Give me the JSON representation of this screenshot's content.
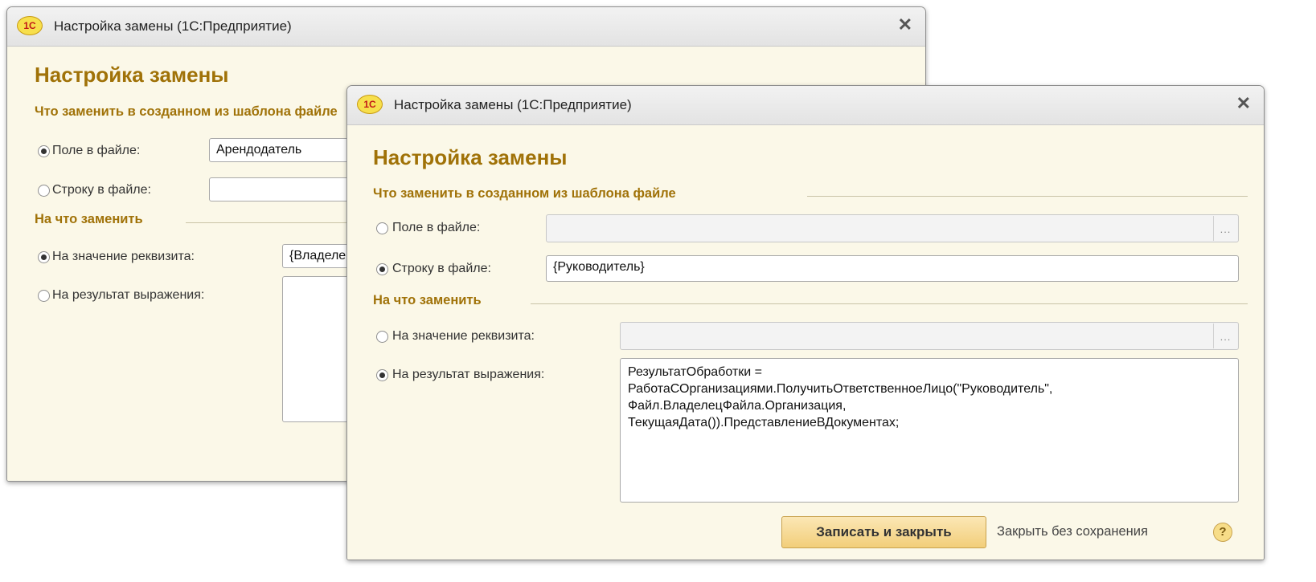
{
  "back_window": {
    "app_icon": "1C",
    "title": "Настройка замены  (1С:Предприятие)",
    "close_icon": "✕",
    "form_title": "Настройка замены",
    "group_what": "Что заменить в созданном из шаблона файле",
    "radio_field_label": "Поле в файле:",
    "radio_field_selected": true,
    "field_value": "Арендодатель",
    "radio_string_label": "Строку в файле:",
    "radio_string_selected": false,
    "string_value": "",
    "group_to": "На что заменить",
    "radio_attr_label": "На значение реквизита:",
    "radio_attr_selected": true,
    "attr_value": "{Владелец",
    "radio_expr_label": "На результат выражения:",
    "radio_expr_selected": false,
    "expr_value": ""
  },
  "front_window": {
    "app_icon": "1C",
    "title": "Настройка замены  (1С:Предприятие)",
    "close_icon": "✕",
    "form_title": "Настройка замены",
    "group_what": "Что заменить в созданном из шаблона файле",
    "radio_field_label": "Поле в файле:",
    "radio_field_selected": false,
    "field_value": "",
    "select_button": "...",
    "radio_string_label": "Строку в файле:",
    "radio_string_selected": true,
    "string_value": "{Руководитель}",
    "group_to": "На что заменить",
    "radio_attr_label": "На значение реквизита:",
    "radio_attr_selected": false,
    "attr_value": "",
    "radio_expr_label": "На результат выражения:",
    "radio_expr_selected": true,
    "expr_value": "РезультатОбработки =\nРаботаСОрганизациями.ПолучитьОтветственноеЛицо(\"Руководитель\",\nФайл.ВладелецФайла.Организация,\nТекущаяДата()).ПредставлениеВДокументах;",
    "save_button": "Записать и закрыть",
    "close_no_save": "Закрыть без сохранения",
    "help_icon": "?"
  }
}
